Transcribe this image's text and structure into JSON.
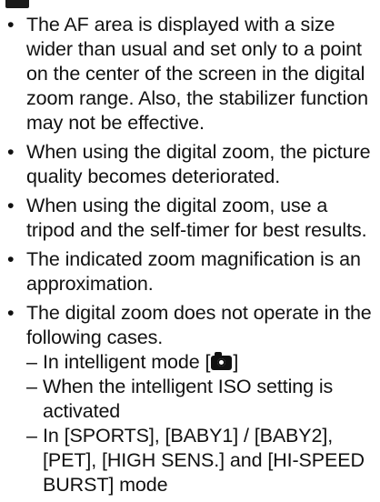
{
  "notes": {
    "items": [
      "The AF area is displayed with a size wider than usual and set only to a point on the center of the screen in the digital zoom range. Also, the stabilizer function may not be effective.",
      "When using the digital zoom, the picture quality becomes deteriorated.",
      "When using the digital zoom, use a tripod and the self-timer for best results.",
      "The indicated zoom magnification is an approximation."
    ],
    "last_item": "The digital zoom does not operate in the following cases.",
    "cases": {
      "intelligent_prefix": "In intelligent mode [",
      "intelligent_suffix": "]",
      "intelligent_icon": "camera-icon",
      "iso": "When the intelligent ISO setting is activated",
      "modes": "In [SPORTS], [BABY1] / [BABY2], [PET], [HIGH SENS.] and [HI-SPEED BURST] mode"
    }
  }
}
